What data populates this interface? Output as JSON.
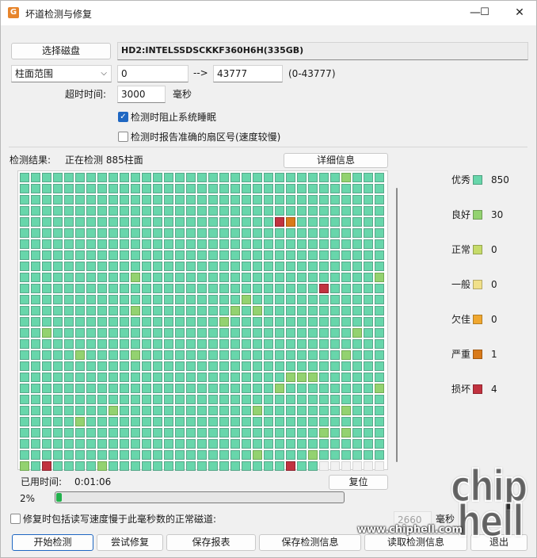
{
  "window": {
    "title": "坏道检测与修复",
    "icon": "app-icon",
    "controls": {
      "minimize": "—",
      "maximize": "☐",
      "close": "✕"
    }
  },
  "disk": {
    "select_button": "选择磁盘",
    "name": "HD2:INTELSSDSCKKF360H6H(335GB)"
  },
  "range": {
    "mode": "柱面范围",
    "start": "0",
    "arrow": "-->",
    "end": "43777",
    "hint": "(0-43777)"
  },
  "timeout": {
    "label": "超时时间:",
    "value": "3000",
    "unit": "毫秒"
  },
  "options": {
    "prevent_sleep": {
      "label": "检测时阻止系统睡眠",
      "checked": true
    },
    "report_sector": {
      "label": "检测时报告准确的扇区号(速度较慢)",
      "checked": false
    }
  },
  "result": {
    "label": "检测结果:",
    "status": "正在检测 885柱面",
    "details_button": "详细信息"
  },
  "grid": {
    "columns": 33,
    "total_cells": 891,
    "special": {
      "g": [
        29,
        307,
        329,
        383,
        406,
        415,
        417,
        447,
        464,
        492,
        533,
        538,
        557,
        618,
        619,
        620,
        650,
        659,
        701,
        714,
        722,
        731,
        786,
        788,
        846,
        851,
        858,
        860,
        865
      ],
      "r": [
        155,
        357,
        860,
        882
      ],
      "o": [
        156
      ]
    },
    "empty_from": 885
  },
  "legend": [
    {
      "label": "优秀",
      "color": "#68d6ab",
      "count": "850"
    },
    {
      "label": "良好",
      "color": "#93d270",
      "count": "30"
    },
    {
      "label": "正常",
      "color": "#c6db6a",
      "count": "0"
    },
    {
      "label": "一般",
      "color": "#f1e08a",
      "count": "0"
    },
    {
      "label": "欠佳",
      "color": "#f0a830",
      "count": "0"
    },
    {
      "label": "严重",
      "color": "#d87a1a",
      "count": "1"
    },
    {
      "label": "损坏",
      "color": "#c1323f",
      "count": "4"
    }
  ],
  "elapsed": {
    "label": "已用时间:",
    "value": "0:01:06",
    "reset_button": "复位"
  },
  "progress": {
    "percent_label": "2%",
    "fraction": 0.02
  },
  "repair_option": {
    "label": "修复时包括读写速度慢于此毫秒数的正常磁道:",
    "checked": false,
    "value": "2660",
    "unit": "毫秒"
  },
  "actions": {
    "start": "开始检测",
    "try_repair": "尝试修复",
    "save_report": "保存报表",
    "save_info": "保存检测信息",
    "load_info": "读取检测信息",
    "exit": "退出"
  },
  "watermark": {
    "chip": "chip",
    "hell": "hell",
    "url": "www.chiphell.com"
  }
}
